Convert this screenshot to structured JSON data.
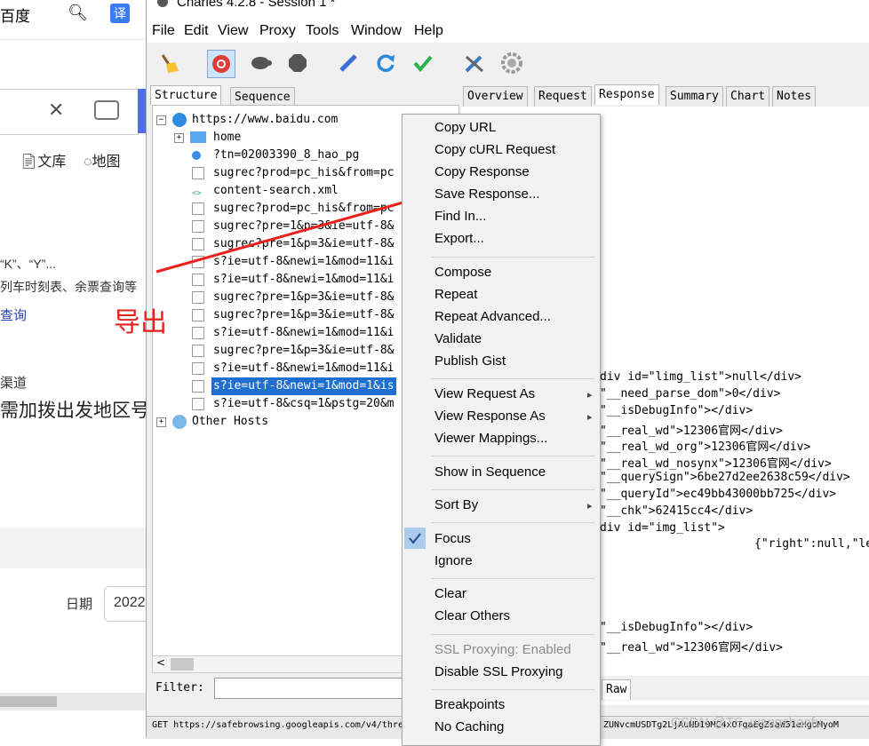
{
  "background_browser": {
    "search_label": "百度",
    "translate_label": "译",
    "nav_wenku": "文库",
    "nav_map": "地图",
    "text_ky": "“K”、“Y”...",
    "text_timetable": "列车时刻表、余票查询等",
    "link_query": "查询",
    "text_channel": "渠道",
    "text_region": "需加拨出发地区号",
    "date_label": "日期",
    "date_value": "2022"
  },
  "app": {
    "title": "Charles 4.2.8 - Session 1 *"
  },
  "menubar": [
    "File",
    "Edit",
    "View",
    "Proxy",
    "Tools",
    "Window",
    "Help"
  ],
  "toolbar": {
    "icons": [
      "broom-icon",
      "record-icon",
      "throttle-turtle-icon",
      "breakpoint-hexagon-icon",
      "compose-pen-icon",
      "repeat-refresh-icon",
      "validate-check-icon",
      "tools-icon",
      "settings-gear-icon"
    ]
  },
  "left_tabs": [
    "Structure",
    "Sequence"
  ],
  "tree": {
    "root_host": "https://www.baidu.com",
    "items": [
      "home",
      "?tn=02003390_8_hao_pg",
      "sugrec?prod=pc_his&from=pc",
      "content-search.xml",
      "sugrec?prod=pc_his&from=pc",
      "sugrec?pre=1&p=3&ie=utf-8&",
      "sugrec?pre=1&p=3&ie=utf-8&",
      "s?ie=utf-8&newi=1&mod=11&i",
      "s?ie=utf-8&newi=1&mod=11&i",
      "sugrec?pre=1&p=3&ie=utf-8&",
      "sugrec?pre=1&p=3&ie=utf-8&",
      "s?ie=utf-8&newi=1&mod=11&i",
      "sugrec?pre=1&p=3&ie=utf-8&",
      "s?ie=utf-8&newi=1&mod=11&i",
      "s?ie=utf-8&newi=1&mod=1&is",
      "s?ie=utf-8&csq=1&pstg=20&m"
    ],
    "other_hosts": "Other Hosts"
  },
  "filter": {
    "label": "Filter:",
    "value": ""
  },
  "right_tabs": [
    "Overview",
    "Request",
    "Response",
    "Summary",
    "Chart",
    "Notes"
  ],
  "response_lines": [
    "div id=\"limg_list\">null</div>",
    "\"__need_parse_dom\">0</div>",
    "\"__isDebugInfo\"></div>",
    "\"__real_wd\">12306官网</div>",
    "\"__real_wd_org\">12306官网</div>",
    "\"__real_wd_nosynx\">12306官网</div>",
    "\"__querySign\">6be27d2ee2638c59</div>",
    "\"__queryId\">ec49bb43000bb725</div>",
    "\"__chk\">62415cc4</div>",
    "div id=\"img_list\">",
    "{\"right\":null,\"le",
    "\"__isDebugInfo\"></div>",
    "\"__real_wd\">12306官网</div>"
  ],
  "raw_tab": "Raw",
  "status": {
    "text": "GET https://safebrowsing.googleapis.com/v4/thre",
    "text_right": "ZUNvcmUSDTg2LjAuNDI0MC4xOTgaEgZsaW51eHgoMyoM"
  },
  "watermark": "CSDN @TS_wangshaofu",
  "annotation": {
    "label": "导出",
    "color": "#e8211d"
  },
  "context_menu": {
    "groups": [
      [
        "Copy URL",
        "Copy cURL Request",
        "Copy Response",
        "Save Response...",
        "Find In...",
        "Export..."
      ],
      [
        "Compose",
        "Repeat",
        "Repeat Advanced...",
        "Validate",
        "Publish Gist"
      ],
      [
        "View Request As",
        "View Response As",
        "Viewer Mappings..."
      ],
      [
        "Show in Sequence"
      ],
      [
        "Sort By"
      ],
      [
        "Focus",
        "Ignore"
      ],
      [
        "Clear",
        "Clear Others"
      ],
      [
        "SSL Proxying: Enabled",
        "Disable SSL Proxying"
      ],
      [
        "Breakpoints",
        "No Caching"
      ]
    ],
    "checked_item": "Focus",
    "disabled_item": "SSL Proxying: Enabled"
  }
}
